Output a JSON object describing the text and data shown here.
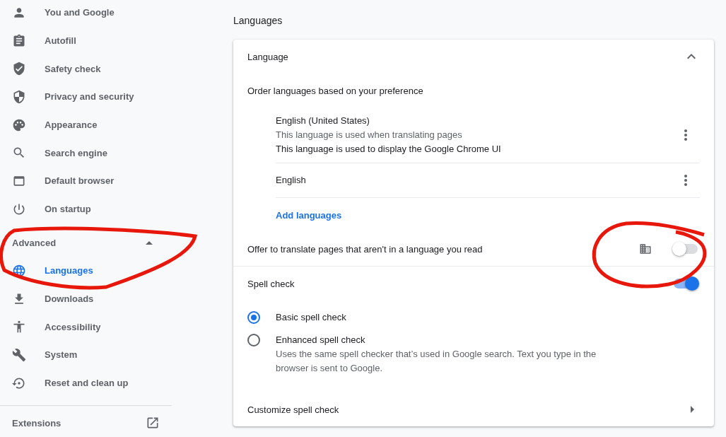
{
  "sidebar": {
    "items": [
      {
        "label": "You and Google",
        "selected": false
      },
      {
        "label": "Autofill",
        "selected": false
      },
      {
        "label": "Safety check",
        "selected": false
      },
      {
        "label": "Privacy and security",
        "selected": false
      },
      {
        "label": "Appearance",
        "selected": false
      },
      {
        "label": "Search engine",
        "selected": false
      },
      {
        "label": "Default browser",
        "selected": false
      },
      {
        "label": "On startup",
        "selected": false
      }
    ],
    "advanced": {
      "label": "Advanced",
      "expanded": true,
      "items": [
        {
          "label": "Languages",
          "selected": true
        },
        {
          "label": "Downloads",
          "selected": false
        },
        {
          "label": "Accessibility",
          "selected": false
        },
        {
          "label": "System",
          "selected": false
        },
        {
          "label": "Reset and clean up",
          "selected": false
        }
      ]
    },
    "extensions": {
      "label": "Extensions"
    }
  },
  "main": {
    "title": "Languages",
    "card": {
      "header": {
        "title": "Language",
        "expanded": true
      },
      "order_label": "Order languages based on your preference",
      "languages": [
        {
          "name": "English (United States)",
          "lines": [
            {
              "text": "This language is used when translating pages",
              "kind": "muted"
            },
            {
              "text": "This language is used to display the Google Chrome UI",
              "kind": "normal"
            }
          ]
        },
        {
          "name": "English"
        }
      ],
      "add_link": "Add languages",
      "translate": {
        "label": "Offer to translate pages that aren't in a language you read",
        "on": false
      },
      "spell_check": {
        "label": "Spell check",
        "on": true
      },
      "spell_options": [
        {
          "label": "Basic spell check",
          "selected": true
        },
        {
          "label": "Enhanced spell check",
          "description": "Uses the same spell checker that’s used in Google search. Text you type in the browser is sent to Google.",
          "selected": false
        }
      ],
      "customize": {
        "label": "Customize spell check"
      }
    }
  }
}
